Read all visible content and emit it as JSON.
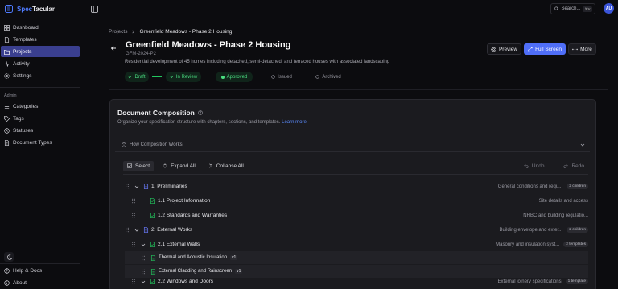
{
  "brand": {
    "name_part1": "Spec",
    "name_part2": "Tacular"
  },
  "sidebar": {
    "main_items": [
      {
        "label": "Dashboard",
        "icon": "dashboard-icon"
      },
      {
        "label": "Templates",
        "icon": "templates-icon"
      },
      {
        "label": "Projects",
        "icon": "projects-icon",
        "active": true
      },
      {
        "label": "Activity",
        "icon": "activity-icon"
      },
      {
        "label": "Settings",
        "icon": "settings-icon"
      }
    ],
    "admin_label": "Admin",
    "admin_items": [
      {
        "label": "Categories",
        "icon": "categories-icon"
      },
      {
        "label": "Tags",
        "icon": "tags-icon"
      },
      {
        "label": "Statuses",
        "icon": "statuses-icon"
      },
      {
        "label": "Document Types",
        "icon": "document-types-icon"
      }
    ],
    "bottom_items": [
      {
        "label": "Help & Docs",
        "icon": "help-icon"
      },
      {
        "label": "About",
        "icon": "info-icon"
      }
    ]
  },
  "topbar": {
    "search_label": "Search...",
    "search_shortcut": "⌘K",
    "avatar_initials": "AU"
  },
  "breadcrumb": {
    "parent": "Projects",
    "current": "Greenfield Meadows - Phase 2 Housing"
  },
  "project": {
    "title": "Greenfield Meadows - Phase 2 Housing",
    "code": "GFM-2024-P2",
    "description": "Residential development of 45 homes including detached, semi-detached, and terraced houses with associated landscaping"
  },
  "actions": {
    "preview": "Preview",
    "full_screen": "Full Screen",
    "more": "More"
  },
  "workflow": {
    "draft": "Draft",
    "in_review": "In Review",
    "approved": "Approved",
    "issued": "Issued",
    "archived": "Archived"
  },
  "composition": {
    "title": "Document Composition",
    "subtitle": "Organize your specification structure with chapters, sections, and templates.",
    "learn_more": "Learn more",
    "how_it_works": "How Composition Works",
    "toolbar": {
      "select": "Select",
      "expand_all": "Expand All",
      "collapse_all": "Collapse All",
      "undo": "Undo",
      "redo": "Redo"
    },
    "tree": [
      {
        "label": "1. Preliminaries",
        "desc": "General conditions and requ...",
        "badge": "2 children"
      },
      {
        "label": "1.1 Project Information",
        "desc": "Site details and access",
        "badge": ""
      },
      {
        "label": "1.2 Standards and Warranties",
        "desc": "NHBC and building regulatio...",
        "badge": ""
      },
      {
        "label": "2. External Works",
        "desc": "Building envelope and exter...",
        "badge": "2 children"
      },
      {
        "label": "2.1 External Walls",
        "desc": "Masonry and insulation syst...",
        "badge": "2 templates"
      },
      {
        "label": "Thermal and Acoustic Insulation",
        "version": "v1"
      },
      {
        "label": "External Cladding and Rainscreen",
        "version": "v1"
      },
      {
        "label": "2.2 Windows and Doors",
        "desc": "External joinery specifications",
        "badge": "1 template"
      }
    ]
  },
  "colors": {
    "accent": "#4f6ef7",
    "active_nav": "#3a3f8f",
    "status_green": "#4ade80"
  }
}
